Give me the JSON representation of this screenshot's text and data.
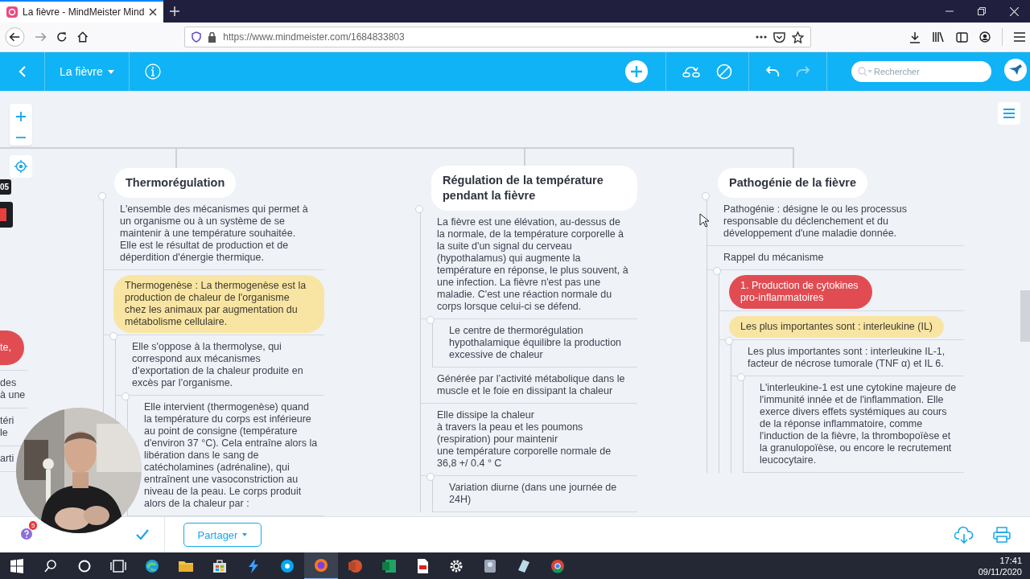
{
  "browser": {
    "tab_title": "La fièvre - MindMeister Mind",
    "url": "https://www.mindmeister.com/1684833803"
  },
  "app_bar": {
    "map_title": "La fièvre",
    "search_placeholder": "Rechercher",
    "undo": {
      "disabled": false
    },
    "redo": {
      "disabled": true
    }
  },
  "map": {
    "timer_badge": "05",
    "left_fragments": [
      {
        "text": "te,",
        "kind": "alert"
      },
      {
        "text": "des\nà une",
        "kind": "plain"
      },
      {
        "text": "téri\nle",
        "kind": "plain"
      },
      {
        "text": "arti",
        "kind": "plain"
      }
    ],
    "columns": [
      {
        "title": "Thermorégulation",
        "items": [
          {
            "text": "L'ensemble des mécanismes qui permet à un organisme ou à un système de se maintenir à une température souhaitée.\nElle est le résultat de production et de déperdition d'énergie thermique.",
            "kind": "plain"
          },
          {
            "text": "Thermogenèse : La thermogenèse est la production de chaleur de l'organisme chez les animaux par augmentation du métabolisme cellulaire.",
            "kind": "highlight",
            "children": [
              {
                "text": "Elle s'oppose à la thermolyse, qui correspond aux mécanismes d’exportation de la chaleur produite en excès par l’organisme.",
                "kind": "plain",
                "children": [
                  {
                    "text": "Elle intervient (thermogenèse) quand la température du corps est inférieure au point de consigne (température d'environ 37 °C). Cela entraîne alors la libération dans le sang de catécholamines (adrénaline), qui entraînent une vasoconstriction au niveau de la peau. Le corps produit alors de la chaleur par :",
                    "kind": "plain"
                  }
                ]
              }
            ]
          }
        ]
      },
      {
        "title": "Régulation de la température pendant la fièvre",
        "items": [
          {
            "text": "La fièvre est une élévation, au-dessus de la normale, de la température corporelle à la suite d'un signal du cerveau (hypothalamus) qui augmente la température en réponse, le plus souvent, à une infection. La fièvre n'est pas une maladie. C'est une réaction normale du corps lorsque celui-ci se défend.",
            "kind": "plain",
            "children": [
              {
                "text": "Le centre de thermorégulation hypothalamique équilibre la production excessive de chaleur",
                "kind": "plain"
              }
            ]
          },
          {
            "text": "Générée par l’activité métabolique dans le muscle et le foie en dissipant la chaleur",
            "kind": "plain"
          },
          {
            "text": "Elle dissipe la chaleur\nà travers la peau et les poumons\n(respiration) pour maintenir\nune température corporelle normale de 36,8 +/ 0.4 ° C",
            "kind": "plain",
            "children": [
              {
                "text": "Variation diurne (dans une journée de 24H)",
                "kind": "plain"
              }
            ]
          }
        ]
      },
      {
        "title": "Pathogénie de la fièvre",
        "items": [
          {
            "text": "Pathogénie : désigne le ou les processus responsable du déclenchement et du développement d'une maladie donnée.",
            "kind": "plain"
          },
          {
            "text": "Rappel du mécanisme",
            "kind": "plain",
            "children": [
              {
                "text": "1. Production de cytokines pro-inflammatoires",
                "kind": "alert"
              },
              {
                "text": "Les plus importantes sont : interleukine (IL)",
                "kind": "highlight",
                "children": [
                  {
                    "text": "Les plus importantes sont : interleukine IL-1, facteur de nécrose tumorale (TNF α) et IL 6.",
                    "kind": "plain",
                    "children": [
                      {
                        "text": "L'interleukine-1 est une cytokine majeure de l'immunité innée et de l'inflammation. Elle exerce divers effets systémiques au cours de la réponse inflammatoire, comme l'induction de la fièvre, la thrombopoïèse et la granulopoïèse, ou encore le recrutement leucocytaire.",
                        "kind": "plain"
                      }
                    ]
                  }
                ]
              }
            ]
          }
        ]
      }
    ]
  },
  "bottom_bar": {
    "help_badge": "5",
    "share_label": "Partager"
  },
  "taskbar": {
    "time": "17:41",
    "date": "09/11/2020"
  }
}
